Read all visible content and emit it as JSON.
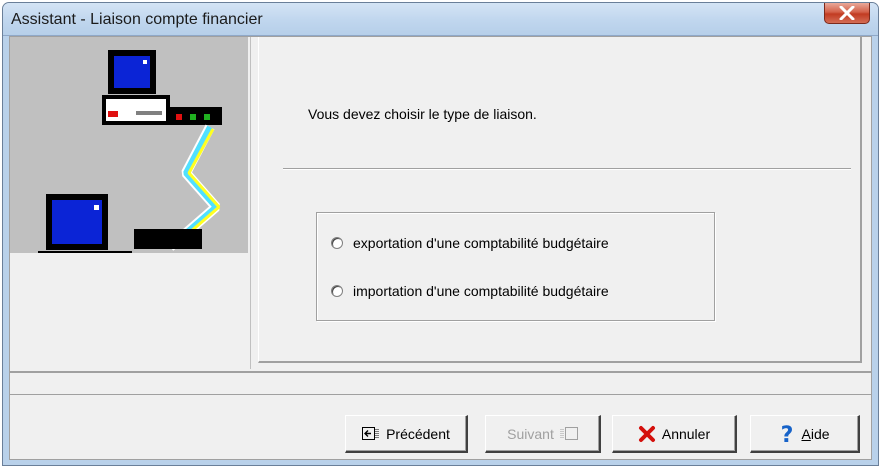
{
  "window": {
    "title": "Assistant - Liaison compte financier",
    "close_icon": "close-icon"
  },
  "wizard": {
    "instruction": "Vous devez choisir le type de liaison.",
    "options": [
      {
        "label": "exportation d'une comptabilité budgétaire",
        "selected": false
      },
      {
        "label": "importation d'une comptabilité budgétaire",
        "selected": false
      }
    ]
  },
  "buttons": {
    "previous": {
      "label": "Précédent",
      "icon": "previous-icon",
      "enabled": true
    },
    "next": {
      "label": "Suivant",
      "icon": "next-icon",
      "enabled": false
    },
    "cancel": {
      "label": "Annuler",
      "icon": "red-x-icon",
      "enabled": true
    },
    "help": {
      "label_first": "A",
      "label_rest": "ide",
      "icon": "question-mark-icon",
      "enabled": true
    }
  },
  "colors": {
    "title_bar": "#c0d6ee",
    "close_button": "#c23b22",
    "dialog_face": "#f0f0f0",
    "illustration_bg": "#c0c0c0",
    "cancel_x": "#d4100c",
    "help_question": "#1763c9"
  }
}
